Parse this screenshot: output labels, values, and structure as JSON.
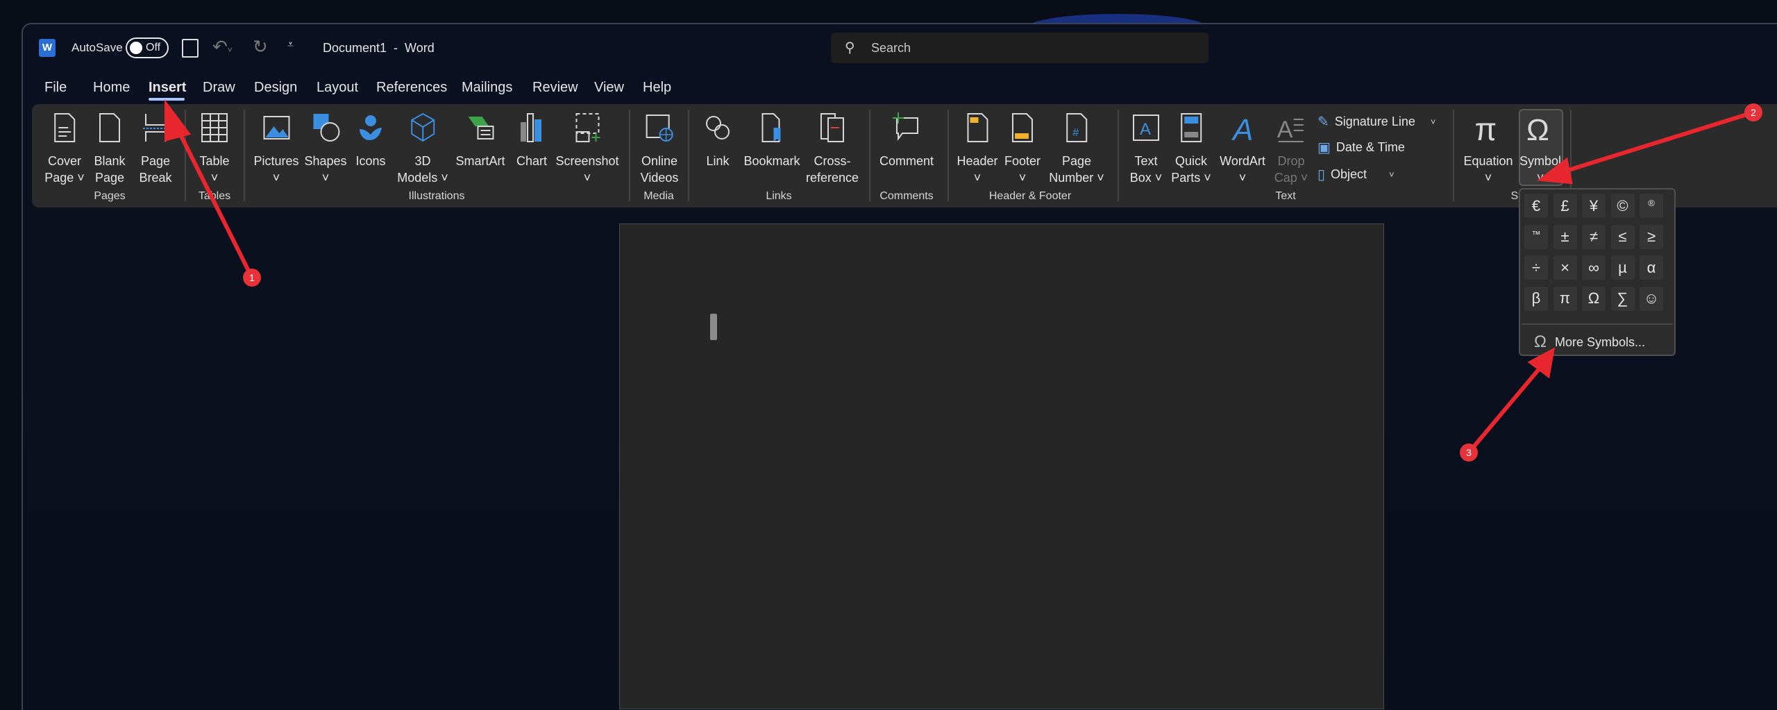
{
  "titlebar": {
    "app_icon": "word-icon",
    "autosave_label": "AutoSave",
    "autosave_state": "Off",
    "title": "Document1  -  Word",
    "search_placeholder": "Search"
  },
  "tabs": [
    "File",
    "Home",
    "Insert",
    "Draw",
    "Design",
    "Layout",
    "References",
    "Mailings",
    "Review",
    "View",
    "Help"
  ],
  "active_tab": "Insert",
  "ribbon": {
    "items": [
      {
        "id": "cover-page",
        "l1": "Cover",
        "l2": "Page ˅",
        "icon": "cover-page-icon"
      },
      {
        "id": "blank-page",
        "l1": "Blank",
        "l2": "Page",
        "icon": "blank-page-icon"
      },
      {
        "id": "page-break",
        "l1": "Page",
        "l2": "Break",
        "icon": "page-break-icon"
      },
      {
        "id": "table",
        "l1": "Table",
        "l2": "˅",
        "icon": "table-icon"
      },
      {
        "id": "pictures",
        "l1": "Pictures",
        "l2": "˅",
        "icon": "pictures-icon"
      },
      {
        "id": "shapes",
        "l1": "Shapes",
        "l2": "˅",
        "icon": "shapes-icon"
      },
      {
        "id": "icons",
        "l1": "Icons",
        "l2": "",
        "icon": "icons-icon"
      },
      {
        "id": "3d-models",
        "l1": "3D",
        "l2": "Models ˅",
        "icon": "cube-icon"
      },
      {
        "id": "smartart",
        "l1": "SmartArt",
        "l2": "",
        "icon": "smartart-icon"
      },
      {
        "id": "chart",
        "l1": "Chart",
        "l2": "",
        "icon": "chart-icon"
      },
      {
        "id": "screenshot",
        "l1": "Screenshot",
        "l2": "˅",
        "icon": "screenshot-icon"
      },
      {
        "id": "online-videos",
        "l1": "Online",
        "l2": "Videos",
        "icon": "online-video-icon"
      },
      {
        "id": "link",
        "l1": "Link",
        "l2": "",
        "icon": "link-icon"
      },
      {
        "id": "bookmark",
        "l1": "Bookmark",
        "l2": "",
        "icon": "bookmark-icon"
      },
      {
        "id": "cross-reference",
        "l1": "Cross-",
        "l2": "reference",
        "icon": "cross-reference-icon"
      },
      {
        "id": "comment",
        "l1": "Comment",
        "l2": "",
        "icon": "comment-icon"
      },
      {
        "id": "header",
        "l1": "Header",
        "l2": "˅",
        "icon": "header-icon"
      },
      {
        "id": "footer",
        "l1": "Footer",
        "l2": "˅",
        "icon": "footer-icon"
      },
      {
        "id": "page-number",
        "l1": "Page",
        "l2": "Number ˅",
        "icon": "page-number-icon"
      },
      {
        "id": "text-box",
        "l1": "Text",
        "l2": "Box ˅",
        "icon": "text-box-icon"
      },
      {
        "id": "quick-parts",
        "l1": "Quick",
        "l2": "Parts ˅",
        "icon": "quick-parts-icon"
      },
      {
        "id": "wordart",
        "l1": "WordArt",
        "l2": "˅",
        "icon": "wordart-icon"
      },
      {
        "id": "drop-cap",
        "l1": "Drop",
        "l2": "Cap ˅",
        "icon": "drop-cap-icon",
        "disabled": true
      },
      {
        "id": "equation",
        "l1": "Equation",
        "l2": "˅",
        "icon": "pi-icon"
      },
      {
        "id": "symbol",
        "l1": "Symbol",
        "l2": "˅",
        "icon": "omega-icon"
      }
    ],
    "small_items": [
      {
        "id": "signature-line",
        "label": "Signature Line",
        "chevron": "˅",
        "icon": "signature-icon"
      },
      {
        "id": "date-time",
        "label": "Date & Time",
        "chevron": "",
        "icon": "calendar-icon"
      },
      {
        "id": "object",
        "label": "Object",
        "chevron": "˅",
        "icon": "object-icon"
      }
    ],
    "groups": [
      "Pages",
      "Tables",
      "Illustrations",
      "Media",
      "Links",
      "Comments",
      "Header & Footer",
      "Text",
      "Symb"
    ]
  },
  "symbol_dropdown": {
    "symbols": [
      "€",
      "£",
      "¥",
      "©",
      "®",
      "™",
      "±",
      "≠",
      "≤",
      "≥",
      "÷",
      "×",
      "∞",
      "µ",
      "α",
      "β",
      "π",
      "Ω",
      "∑",
      "☺"
    ],
    "more_label": "More Symbols..."
  },
  "annotations": {
    "color": "#e8262e",
    "badges": [
      "1",
      "2",
      "3"
    ]
  }
}
